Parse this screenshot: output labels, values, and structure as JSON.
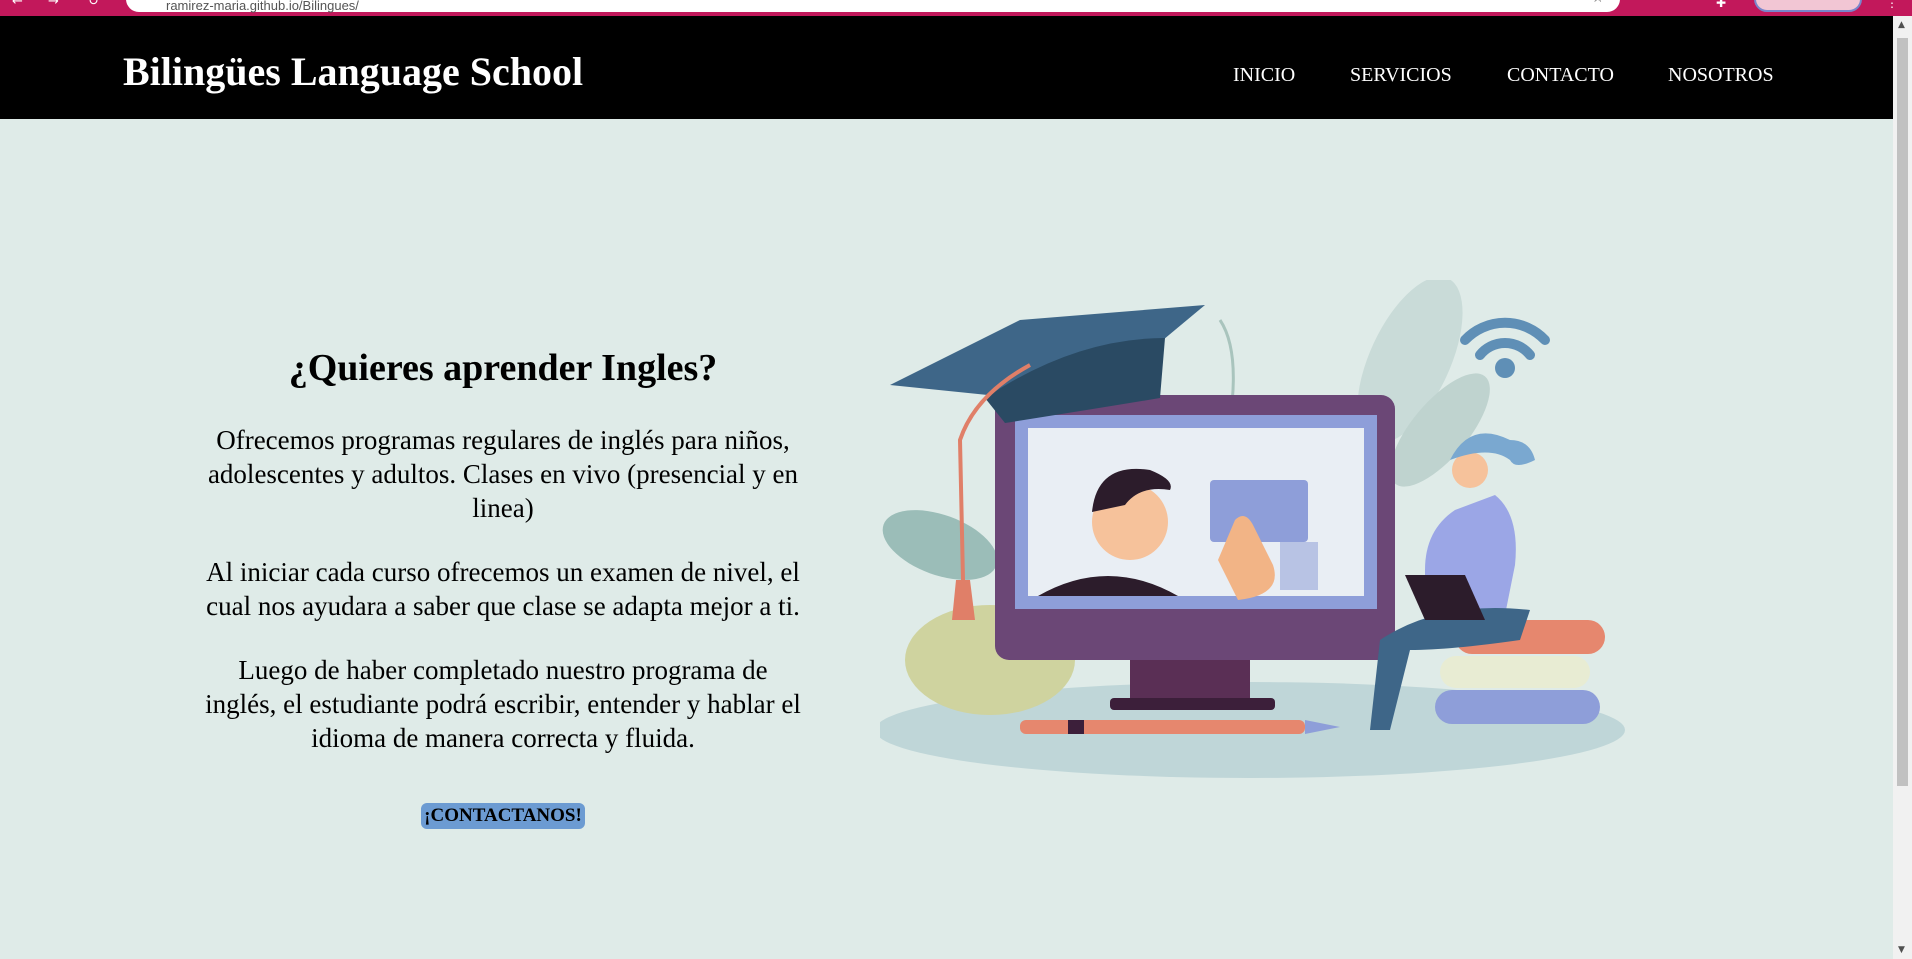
{
  "browser": {
    "url": "ramirez-maria.github.io/Bilingues/"
  },
  "site": {
    "brand": "Bilingües Language School",
    "nav": [
      "INICIO",
      "SERVICIOS",
      "CONTACTO",
      "NOSOTROS"
    ]
  },
  "hero": {
    "title": "¿Quieres aprender Ingles?",
    "paragraphs": [
      "Ofrecemos programas regulares de inglés para niños, adolescentes y adultos. Clases en vivo (presencial y en linea)",
      "Al iniciar cada curso ofrecemos un examen de nivel, el cual nos ayudara a saber que clase se adapta mejor a ti.",
      "Luego de haber completado nuestro programa de inglés, el estudiante podrá escribir, entender y hablar el idioma de manera correcta y fluida."
    ],
    "cta": "¡CONTACTANOS!"
  },
  "colors": {
    "browser_frame": "#c2185b",
    "header_bg": "#000000",
    "page_bg": "#dfebe8",
    "cta_bg": "#6c9bd2"
  },
  "icons": [
    "back-icon",
    "forward-icon",
    "reload-icon",
    "bookmark-star-icon",
    "extensions-icon",
    "profile-avatar-icon"
  ],
  "illustration": {
    "subject": "online-learning-illustration"
  }
}
